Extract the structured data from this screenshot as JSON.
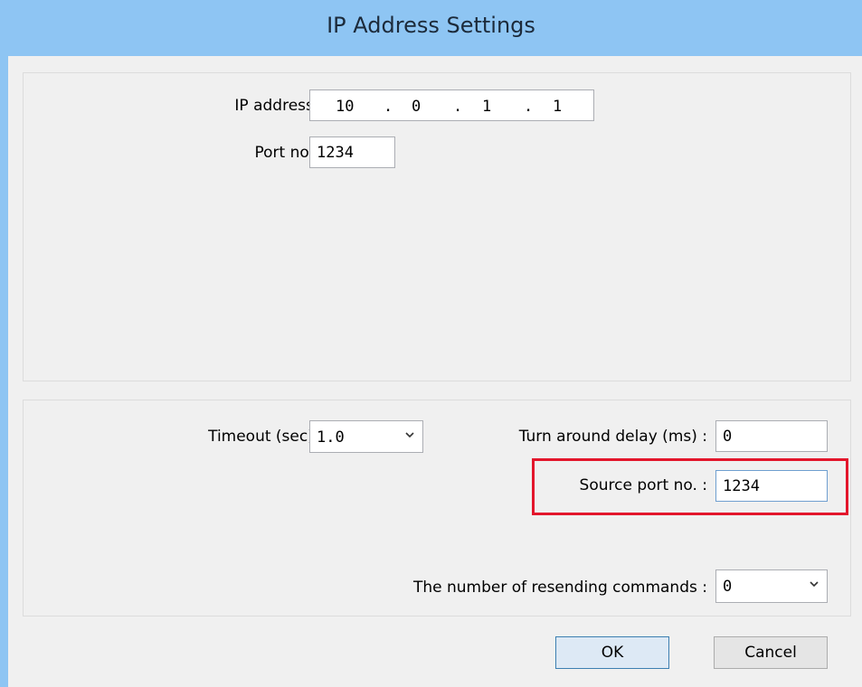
{
  "window": {
    "title": "IP Address Settings"
  },
  "connection": {
    "ip_label": "IP address :",
    "ip_octets": [
      "10",
      "0",
      "1",
      "1"
    ],
    "ip_sep": ".",
    "port_label": "Port no. :",
    "port_value": "1234"
  },
  "options": {
    "timeout_label": "Timeout (sec) :",
    "timeout_value": "1.0",
    "turnaround_label": "Turn around delay (ms) :",
    "turnaround_value": "0",
    "source_port_label": "Source port no. :",
    "source_port_value": "1234",
    "resend_label": "The number of resending commands :",
    "resend_value": "0"
  },
  "buttons": {
    "ok": "OK",
    "cancel": "Cancel"
  },
  "colors": {
    "titlebar": "#8ec5f3",
    "highlight": "#e3162c",
    "dialog_bg": "#f0f0f0"
  }
}
